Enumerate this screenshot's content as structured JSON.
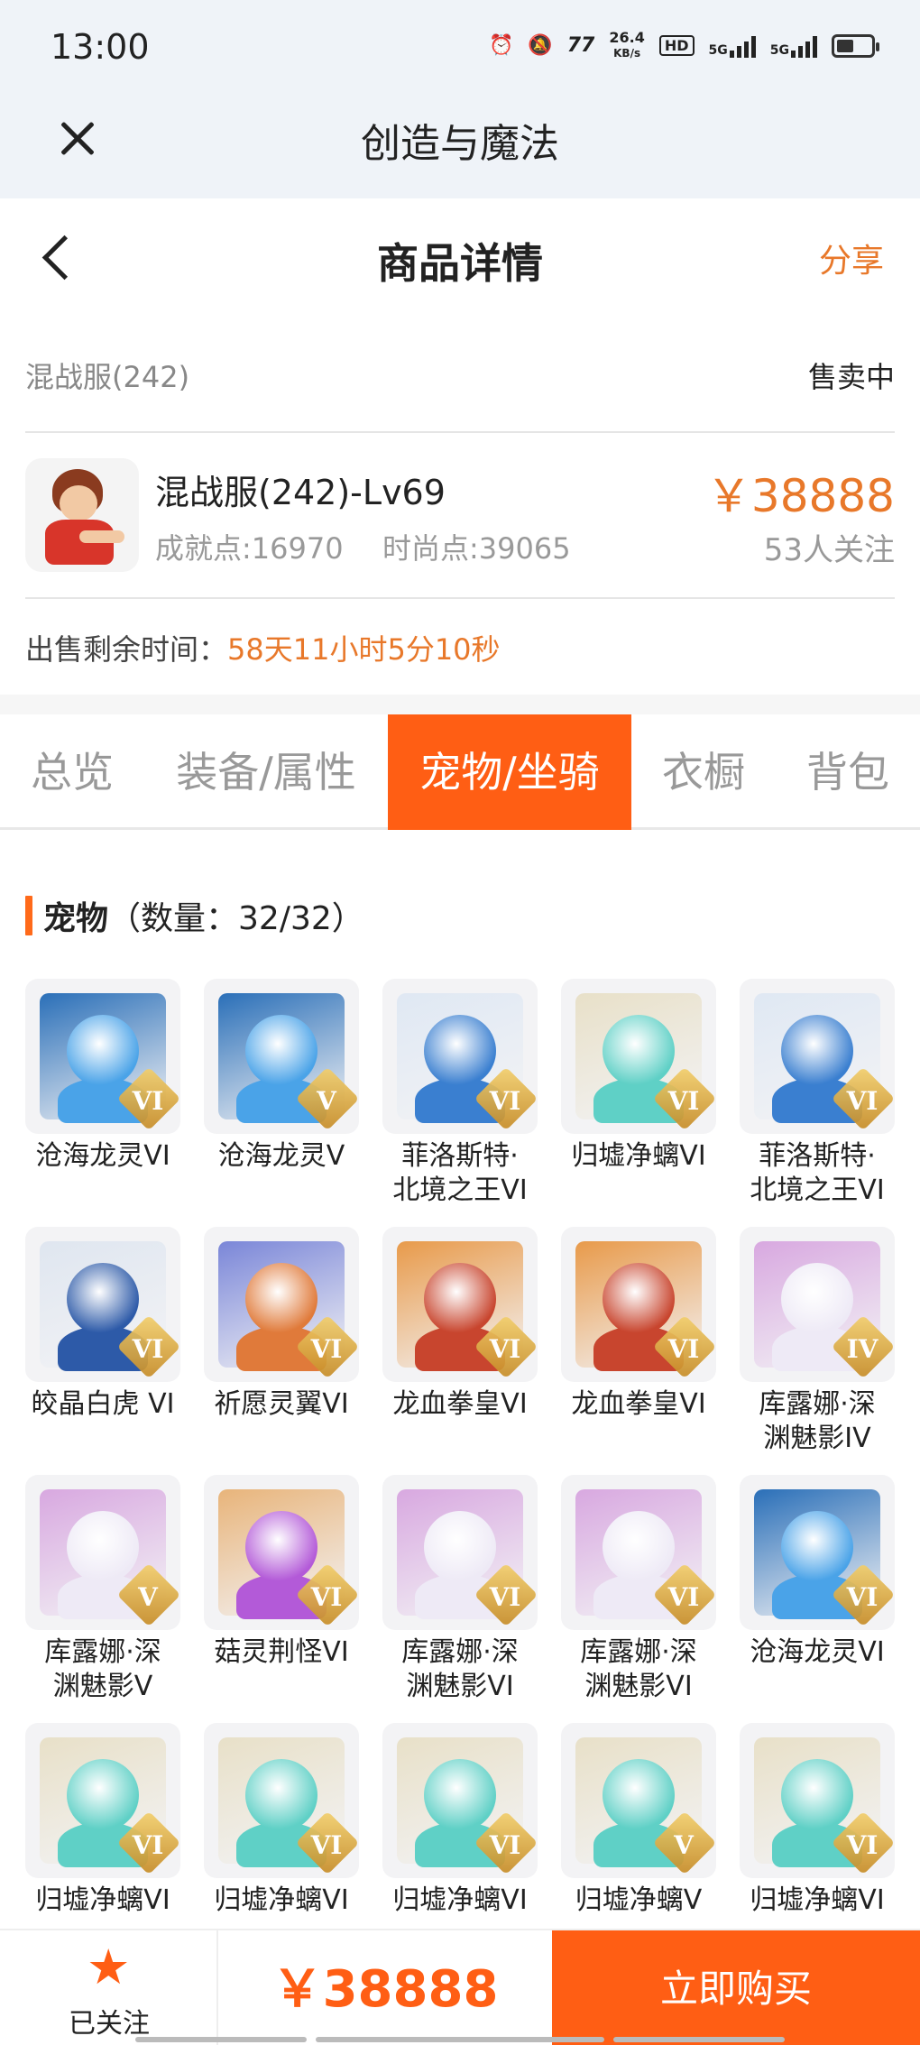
{
  "status_bar": {
    "time": "13:00",
    "net_speed_value": "26.4",
    "net_speed_unit": "KB/s",
    "hd_label": "HD",
    "signal_1": "5G",
    "signal_2": "5G"
  },
  "app_bar": {
    "title": "创造与魔法"
  },
  "page_nav": {
    "title": "商品详情",
    "share_label": "分享"
  },
  "server": {
    "name": "混战服(242)",
    "status": "售卖中"
  },
  "product": {
    "name": "混战服(242)-Lv69",
    "achievement": "成就点:16970",
    "fashion": "时尚点:39065",
    "price": "￥38888",
    "followers": "53人关注"
  },
  "remaining": {
    "label": "出售剩余时间：",
    "value": "58天11小时5分10秒"
  },
  "tabs": [
    {
      "label": "总览",
      "active": false
    },
    {
      "label": "装备/属性",
      "active": false
    },
    {
      "label": "宠物/坐骑",
      "active": true
    },
    {
      "label": "衣橱",
      "active": false
    },
    {
      "label": "背包",
      "active": false
    }
  ],
  "pets_section": {
    "label": "宠物",
    "count": "（数量：32/32）"
  },
  "pets": [
    {
      "name": "沧海龙灵VI",
      "badge": "VI",
      "color": "#4aa3e8",
      "accent": "#2a6fb8"
    },
    {
      "name": "沧海龙灵V",
      "badge": "V",
      "color": "#4aa3e8",
      "accent": "#2a6fb8"
    },
    {
      "name": "菲洛斯特·\n北境之王VI",
      "badge": "VI",
      "color": "#3a7fd0",
      "accent": "#dfe8f3"
    },
    {
      "name": "归墟净螭VI",
      "badge": "VI",
      "color": "#5fd0c6",
      "accent": "#e8e0c8"
    },
    {
      "name": "菲洛斯特·\n北境之王VI",
      "badge": "VI",
      "color": "#3a7fd0",
      "accent": "#dfe8f3"
    },
    {
      "name": "皎晶白虎 VI",
      "badge": "VI",
      "color": "#2d5aa8",
      "accent": "#dfe6f0"
    },
    {
      "name": "祈愿灵翼VI",
      "badge": "VI",
      "color": "#e07a3a",
      "accent": "#7a86d8"
    },
    {
      "name": "龙血拳皇VI",
      "badge": "VI",
      "color": "#c8452e",
      "accent": "#e89a4a"
    },
    {
      "name": "龙血拳皇VI",
      "badge": "VI",
      "color": "#c8452e",
      "accent": "#e89a4a"
    },
    {
      "name": "库露娜·深\n渊魅影IV",
      "badge": "IV",
      "color": "#eeeaf6",
      "accent": "#d8a8e0"
    },
    {
      "name": "库露娜·深\n渊魅影V",
      "badge": "V",
      "color": "#eeeaf6",
      "accent": "#d8a8e0"
    },
    {
      "name": "菇灵荆怪VI",
      "badge": "VI",
      "color": "#b35ad8",
      "accent": "#e8b47a"
    },
    {
      "name": "库露娜·深\n渊魅影VI",
      "badge": "VI",
      "color": "#eeeaf6",
      "accent": "#d8a8e0"
    },
    {
      "name": "库露娜·深\n渊魅影VI",
      "badge": "VI",
      "color": "#eeeaf6",
      "accent": "#d8a8e0"
    },
    {
      "name": "沧海龙灵VI",
      "badge": "VI",
      "color": "#4aa3e8",
      "accent": "#2a6fb8"
    },
    {
      "name": "归墟净螭VI",
      "badge": "VI",
      "color": "#5fd0c6",
      "accent": "#e8e0c8"
    },
    {
      "name": "归墟净螭VI",
      "badge": "VI",
      "color": "#5fd0c6",
      "accent": "#e8e0c8"
    },
    {
      "name": "归墟净螭VI",
      "badge": "VI",
      "color": "#5fd0c6",
      "accent": "#e8e0c8"
    },
    {
      "name": "归墟净螭V",
      "badge": "V",
      "color": "#5fd0c6",
      "accent": "#e8e0c8"
    },
    {
      "name": "归墟净螭VI",
      "badge": "VI",
      "color": "#5fd0c6",
      "accent": "#e8e0c8"
    }
  ],
  "bottom_bar": {
    "follow_label": "已关注",
    "price": "￥38888",
    "buy_label": "立即购买"
  },
  "colors": {
    "accent": "#ff5e14",
    "price": "#e8782a"
  }
}
